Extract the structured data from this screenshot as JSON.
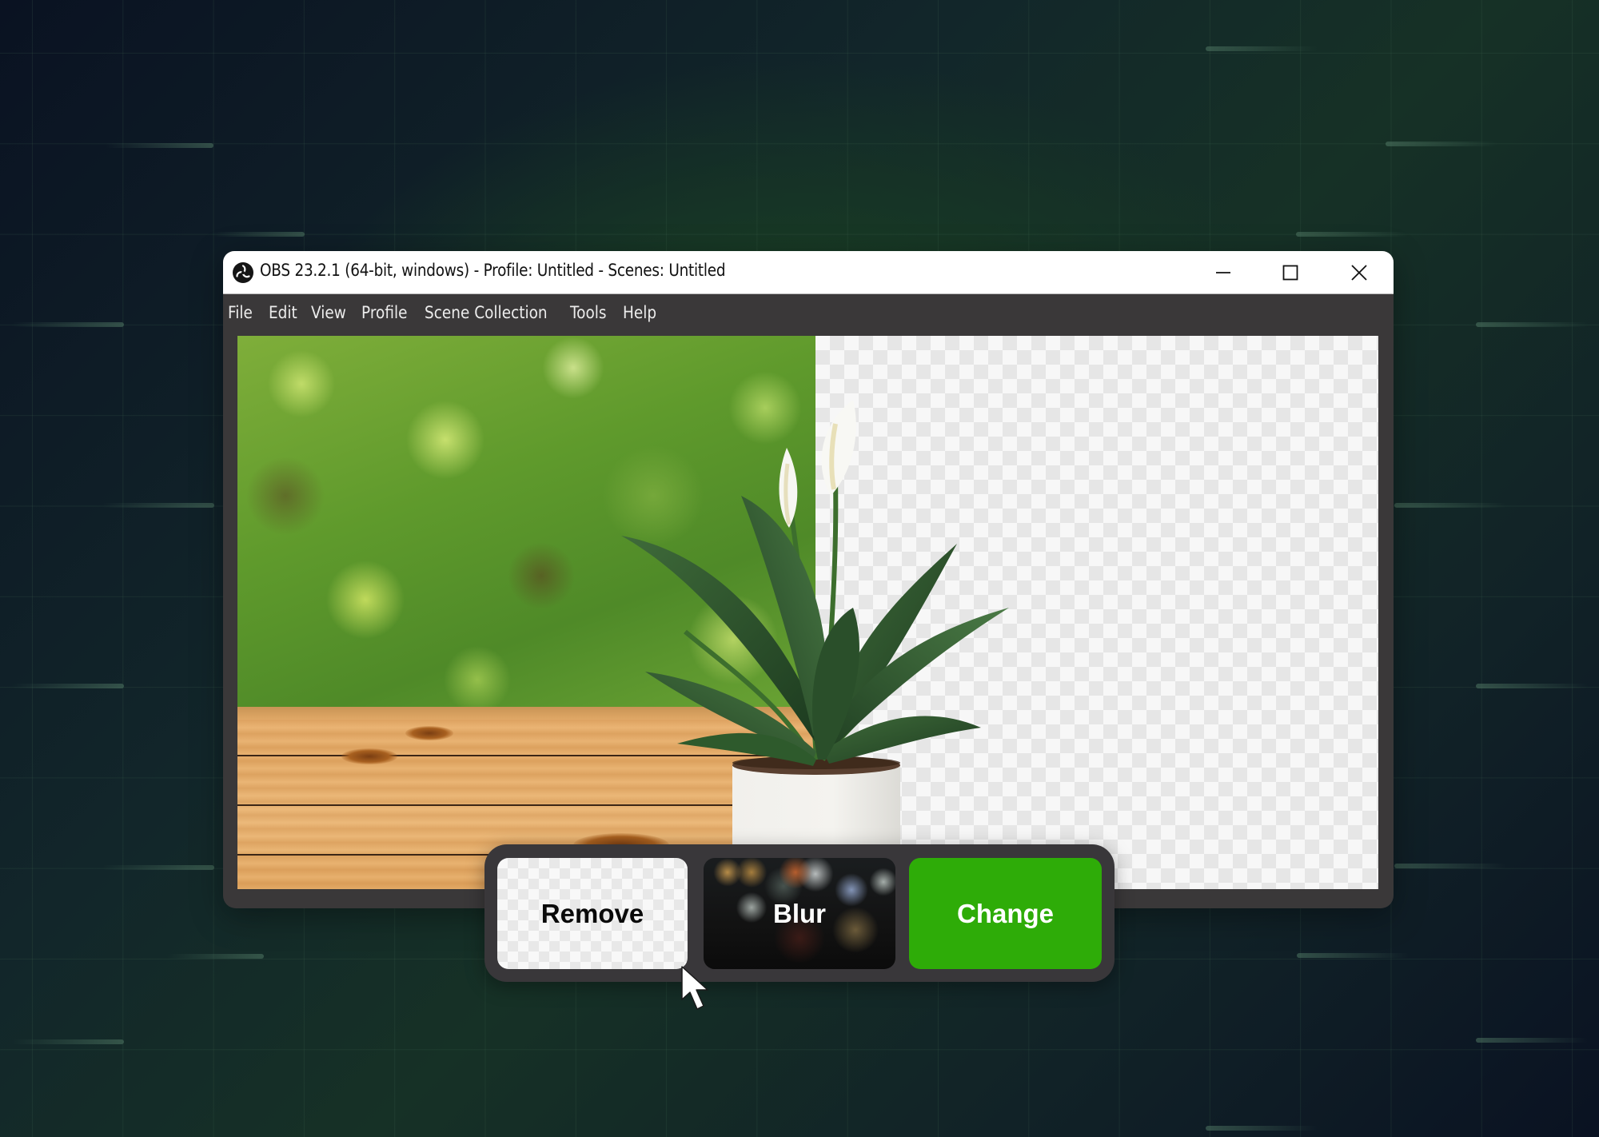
{
  "window": {
    "title": "OBS 23.2.1 (64-bit, windows) - Profile: Untitled - Scenes: Untitled",
    "app_icon": "obs-logo-icon",
    "controls": {
      "minimize_icon": "minimize-icon",
      "maximize_icon": "maximize-icon",
      "close_icon": "close-icon"
    }
  },
  "menu": {
    "items": [
      "File",
      "Edit",
      "View",
      "Profile",
      "Scene Collection",
      "Tools",
      "Help"
    ]
  },
  "preview": {
    "description": "Scene preview: potted peace lily on a wooden table with blurred green foliage background; right half shows transparent (removed) background checkerboard"
  },
  "effects": {
    "buttons": [
      {
        "id": "remove",
        "label": "Remove",
        "background": "transparent-checkerboard"
      },
      {
        "id": "blur",
        "label": "Blur",
        "background": "blurred-bokeh"
      },
      {
        "id": "change",
        "label": "Change",
        "background": "#2eac08"
      }
    ],
    "hovered": "remove"
  },
  "colors": {
    "accent_green": "#2eac08",
    "window_chrome": "#3a3839",
    "titlebar": "#ffffff"
  }
}
